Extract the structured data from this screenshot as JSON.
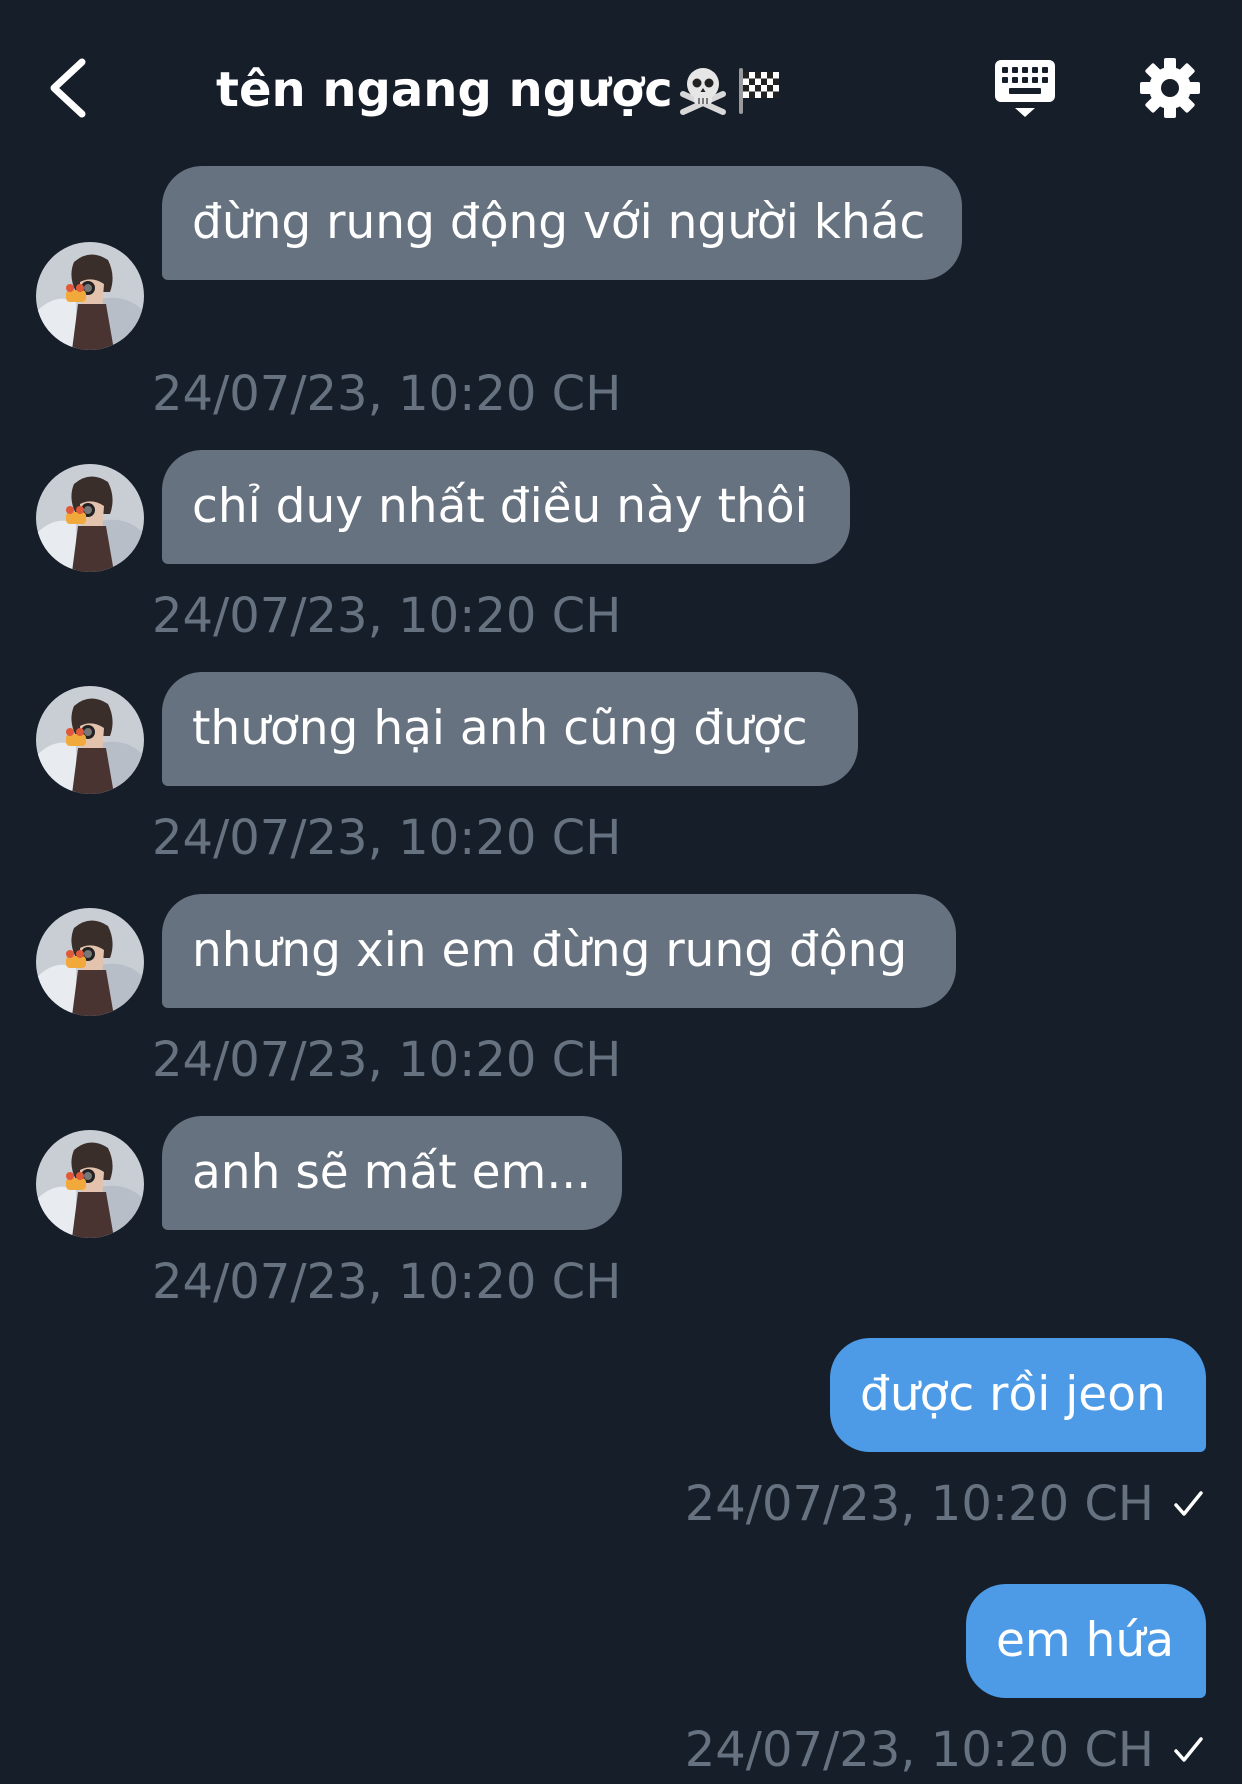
{
  "header": {
    "back_icon": "chevron-left-icon",
    "title": "tên ngang ngược",
    "title_emojis": [
      "skull-crossbones-icon",
      "checkered-flag-icon"
    ],
    "keyboard_icon": "keyboard-icon",
    "settings_icon": "gear-icon"
  },
  "colors": {
    "background": "#161e29",
    "incoming_bubble": "#66727f",
    "outgoing_bubble": "#4d9be6",
    "timestamp": "#66727f",
    "text": "#ffffff"
  },
  "messages": [
    {
      "direction": "in",
      "text": "đừng rung động với người khác",
      "time": "24/07/23, 10:20 CH"
    },
    {
      "direction": "in",
      "text": "chỉ duy nhất điều này thôi",
      "time": "24/07/23, 10:20 CH"
    },
    {
      "direction": "in",
      "text": "thương hại anh cũng được",
      "time": "24/07/23, 10:20 CH"
    },
    {
      "direction": "in",
      "text": "nhưng xin em đừng rung động",
      "time": "24/07/23, 10:20 CH"
    },
    {
      "direction": "in",
      "text": "anh sẽ mất em...",
      "time": "24/07/23, 10:20 CH"
    },
    {
      "direction": "out",
      "text": "được rồi jeon",
      "time": "24/07/23, 10:20 CH",
      "status_icon": "checkmark-icon"
    },
    {
      "direction": "out",
      "text": "em hứa",
      "time": "24/07/23, 10:20 CH",
      "status_icon": "checkmark-icon"
    }
  ]
}
